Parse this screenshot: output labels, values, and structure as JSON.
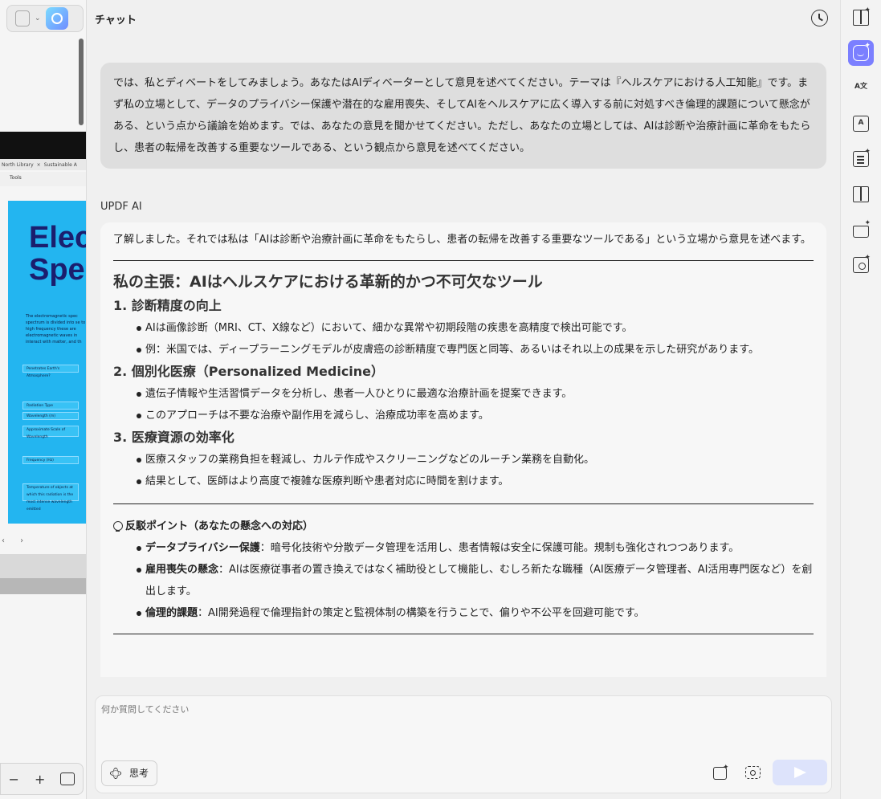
{
  "left_panel": {
    "tab1": "North Library",
    "tab2": "Sustainable A",
    "tools_label": "Tools",
    "doc_title": "Elec\nSpe",
    "doc_body": "The electromagnetic spec spectrum is divided into se to high frequency these are electromagnetic waves in interact with matter, and th",
    "rows": [
      "Penetrates Earth's Atmosphere?",
      "Radiation Type",
      "Wavelength (m)",
      "Approximate Scale of Wavelength",
      "Frequency (Hz)",
      "Temperature of objects at which this radiation is the most intense wavelength emitted"
    ],
    "nav": "‹ ›",
    "zoom_minus": "−",
    "zoom_plus": "+"
  },
  "chat": {
    "title": "チャット",
    "user_message": "では、私とディベートをしてみましょう。あなたはAIディベーターとして意見を述べてください。テーマは『ヘルスケアにおける人工知能』です。まず私の立場として、データのプライバシー保護や潜在的な雇用喪失、そしてAIをヘルスケアに広く導入する前に対処すべき倫理的課題について懸念がある、という点から議論を始めます。では、あなたの意見を聞かせてください。ただし、あなたの立場としては、AIは診断や治療計画に革命をもたらし、患者の転帰を改善する重要なツールである、という観点から意見を述べてください。",
    "ai_name": "UPDF AI",
    "ai_intro": "了解しました。それでは私は「AIは診断や治療計画に革命をもたらし、患者の転帰を改善する重要なツールである」という立場から意見を述べます。",
    "heading": "私の主張：AIはヘルスケアにおける革新的かつ不可欠なツール",
    "sections": [
      {
        "title": "1. 診断精度の向上",
        "bullets": [
          "AIは画像診断（MRI、CT、X線など）において、細かな異常や初期段階の疾患を高精度で検出可能です。",
          "例：米国では、ディープラーニングモデルが皮膚癌の診断精度で専門医と同等、あるいはそれ以上の成果を示した研究があります。"
        ]
      },
      {
        "title": "2. 個別化医療（Personalized Medicine）",
        "bullets": [
          "遺伝子情報や生活習慣データを分析し、患者一人ひとりに最適な治療計画を提案できます。",
          "このアプローチは不要な治療や副作用を減らし、治療成功率を高めます。"
        ]
      },
      {
        "title": "3. 医療資源の効率化",
        "bullets": [
          "医療スタッフの業務負担を軽減し、カルテ作成やスクリーニングなどのルーチン業務を自動化。",
          "結果として、医師はより高度で複雑な医療判断や患者対応に時間を割けます。"
        ]
      }
    ],
    "rebuttal_title": "反駁ポイント（あなたの懸念への対応）",
    "rebuttals": [
      {
        "label": "データプライバシー保護",
        "text": "：暗号化技術や分散データ管理を活用し、患者情報は安全に保護可能。規制も強化されつつあります。"
      },
      {
        "label": "雇用喪失の懸念",
        "text": "：AIは医療従事者の置き換えではなく補助役として機能し、むしろ新たな職種（AI医療データ管理者、AI活用専門医など）を創出します。"
      },
      {
        "label": "倫理的課題",
        "text": "：AI開発過程で倫理指針の策定と監視体制の構築を行うことで、偏りや不公平を回避可能です。"
      }
    ],
    "input_placeholder": "何か質問してください",
    "think_label": "思考"
  },
  "colors": {
    "accent": "#7b7fff",
    "send_disabled": "#dde3fb",
    "user_bubble": "#dedede"
  },
  "rail_icons": [
    "book-ai-icon",
    "chat-ai-icon",
    "translate-icon",
    "translate-box-icon",
    "summary-ai-icon",
    "reader-icon",
    "folder-ai-icon",
    "search-ai-icon"
  ]
}
